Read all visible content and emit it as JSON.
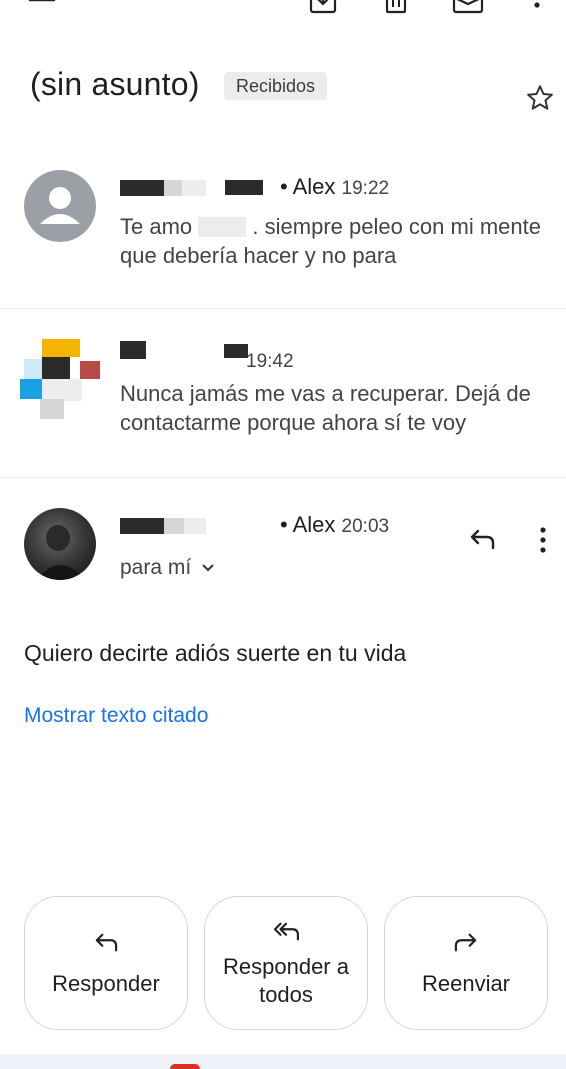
{
  "message_header": {
    "subject": "(sin asunto)",
    "label_chip": "Recibidos"
  },
  "thread": [
    {
      "sender_suffix": "• Alex",
      "time": "19:22",
      "snippet_prefix": "Te amo",
      "snippet_rest": ". siempre peleo con mi mente que debería hacer y no para"
    },
    {
      "sender_suffix": "",
      "time": "19:42",
      "snippet": "Nunca jamás me vas a recuperar. Dejá de contactarme porque ahora sí te voy"
    },
    {
      "sender_suffix": "• Alex",
      "time": "20:03",
      "recipient": "para mí"
    }
  ],
  "body": {
    "text": "Quiero decirte adiós suerte en tu vida",
    "show_quoted": "Mostrar texto citado"
  },
  "actions": {
    "reply": "Responder",
    "reply_all": "Responder a todos",
    "forward": "Reenviar"
  },
  "icons": {
    "back": "arrow-back-icon",
    "archive": "archive-icon",
    "delete": "trash-icon",
    "mark_unread": "mail-icon",
    "more": "more-vert-icon",
    "star": "star-icon",
    "reply": "reply-icon",
    "reply_all": "reply-all-icon",
    "forward": "forward-icon"
  },
  "colors": {
    "link": "#1a73e8",
    "chip_bg": "#ececec",
    "avatar_placeholder": "#9aa0a6"
  }
}
